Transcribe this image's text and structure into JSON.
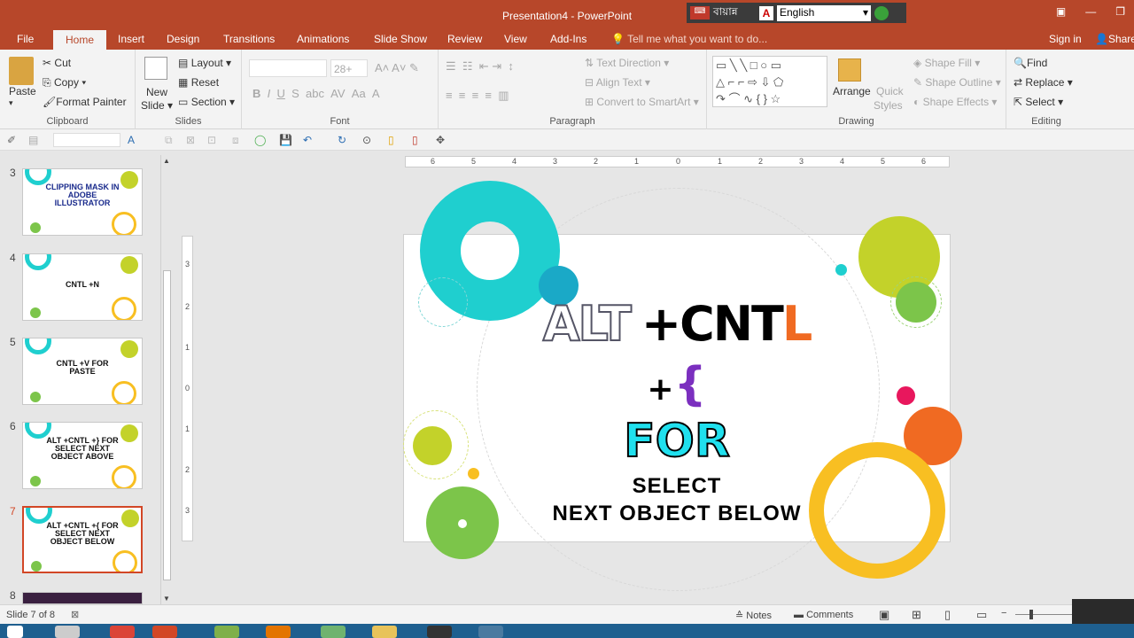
{
  "window": {
    "title": "Presentation4 - PowerPoint"
  },
  "language_bar": {
    "script_label": "বায়ান্ন",
    "lang": "English"
  },
  "tabs": [
    "File",
    "Home",
    "Insert",
    "Design",
    "Transitions",
    "Animations",
    "Slide Show",
    "Review",
    "View",
    "Add-Ins"
  ],
  "tell_me": "Tell me what you want to do...",
  "sign_in": "Sign in",
  "share": "Share",
  "clipboard": {
    "paste": "Paste",
    "cut": "Cut",
    "copy": "Copy",
    "format_painter": "Format Painter",
    "label": "Clipboard"
  },
  "slides_group": {
    "new_slide_1": "New",
    "new_slide_2": "Slide",
    "layout": "Layout",
    "reset": "Reset",
    "section": "Section",
    "label": "Slides"
  },
  "font_group": {
    "size": "28+",
    "label": "Font"
  },
  "paragraph_group": {
    "text_direction": "Text Direction",
    "align_text": "Align Text",
    "convert_smartart": "Convert to SmartArt",
    "label": "Paragraph"
  },
  "drawing_group": {
    "arrange": "Arrange",
    "quick_styles_1": "Quick",
    "quick_styles_2": "Styles",
    "shape_fill": "Shape Fill",
    "shape_outline": "Shape Outline",
    "shape_effects": "Shape Effects",
    "label": "Drawing"
  },
  "editing_group": {
    "find": "Find",
    "replace": "Replace",
    "select": "Select",
    "label": "Editing"
  },
  "ruler": {
    "h_ticks": [
      "6",
      "5",
      "4",
      "3",
      "2",
      "1",
      "0",
      "1",
      "2",
      "3",
      "4",
      "5",
      "6"
    ],
    "v_ticks": [
      "3",
      "2",
      "1",
      "0",
      "1",
      "2",
      "3"
    ]
  },
  "thumbnails": [
    {
      "num": "3",
      "text": "CLIPPING MASK IN ADOBE ILLUSTRATOR"
    },
    {
      "num": "4",
      "text": "CNTL +N"
    },
    {
      "num": "5",
      "text": "CNTL +V FOR PASTE"
    },
    {
      "num": "6",
      "text": "ALT +CNTL +} FOR SELECT NEXT OBJECT ABOVE"
    },
    {
      "num": "7",
      "text": "ALT +CNTL +{ FOR SELECT NEXT OBJECT BELOW"
    },
    {
      "num": "8",
      "text": ""
    }
  ],
  "slide": {
    "alt": "ALT",
    "plus1": "+",
    "cntl": "CNT",
    "cntl_l": "L",
    "plus2": "+",
    "brace": "{",
    "for": "FOR",
    "select": "SELECT",
    "next": "NEXT OBJECT BELOW"
  },
  "status": {
    "slide_info": "Slide 7 of 8",
    "notes": "Notes",
    "comments": "Comments"
  },
  "colors": {
    "accent": "#b7472a",
    "teal": "#1fcfcf",
    "lime": "#c3d22a",
    "green": "#7cc54a",
    "orange": "#f06a22",
    "yellow": "#f8bf22",
    "purple": "#7b2fbf"
  }
}
